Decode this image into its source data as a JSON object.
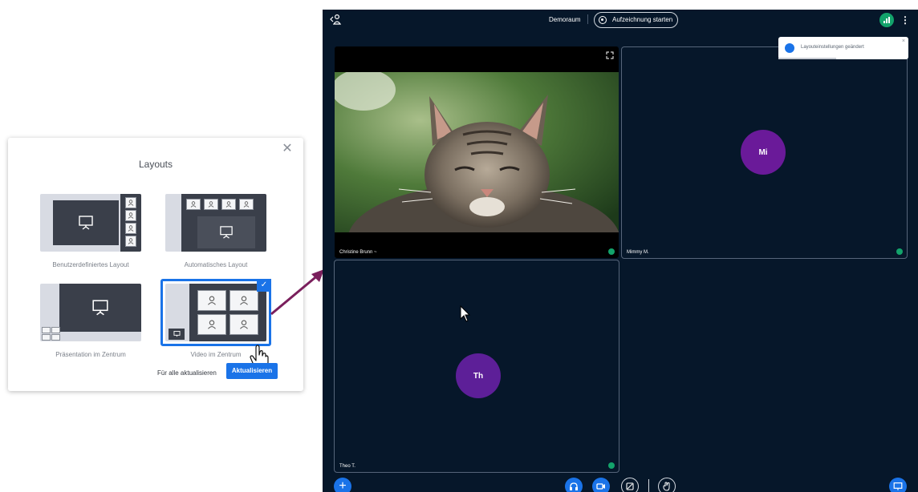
{
  "dialog": {
    "title": "Layouts",
    "close_glyph": "✕",
    "layouts": [
      {
        "label": "Benutzerdefiniertes Layout",
        "selected": false
      },
      {
        "label": "Automatisches Layout",
        "selected": false
      },
      {
        "label": "Präsentation im Zentrum",
        "selected": false
      },
      {
        "label": "Video im Zentrum",
        "selected": true
      }
    ],
    "update_all_label": "Für alle aktualisieren",
    "update_label": "Aktualisieren",
    "check_glyph": "✓"
  },
  "meeting": {
    "room_name": "Demoraum",
    "record_label": "Aufzeichnung starten",
    "more_glyph": "⋮",
    "toast": {
      "text": "Layouteinstellungen geändert",
      "close_glyph": "×"
    },
    "participants": [
      {
        "name": "Christine Brunn",
        "name_suffix": "~",
        "has_video": true
      },
      {
        "name": "Mimmy M.",
        "initials": "Mi",
        "has_video": false
      },
      {
        "name": "Theo T.",
        "initials": "Th",
        "has_video": false
      }
    ],
    "plus_glyph": "+"
  },
  "colors": {
    "accent": "#1a73e8",
    "meeting_bg": "#06172a",
    "status_green": "#13a36b",
    "avatar_purple": "#6a1a99",
    "arrow": "#7a1f5c"
  }
}
